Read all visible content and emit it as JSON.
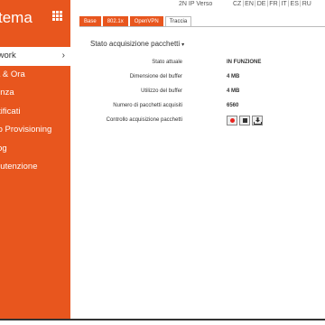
{
  "sidebar": {
    "title": "tema",
    "items": [
      {
        "label": "twork",
        "active": true
      },
      {
        "label": "a & Ora"
      },
      {
        "label": "enza"
      },
      {
        "label": "rtificati"
      },
      {
        "label": "to Provisioning"
      },
      {
        "label": "log"
      },
      {
        "label": "nutenzione"
      }
    ]
  },
  "topbar": {
    "product": "2N IP Verso",
    "languages": [
      "CZ",
      "EN",
      "DE",
      "FR",
      "IT",
      "ES",
      "RU"
    ]
  },
  "tabs": [
    "Base",
    "802.1x",
    "OpenVPN",
    "Traccia"
  ],
  "section": {
    "title": "Stato acquisizione pacchetti",
    "rows": [
      {
        "label": "Stato attuale",
        "value": "IN FUNZIONE"
      },
      {
        "label": "Dimensione del buffer",
        "value": "4 MB"
      },
      {
        "label": "Utilizzo del buffer",
        "value": "4 MB"
      },
      {
        "label": "Numero di pacchetti acquisiti",
        "value": "6560"
      }
    ],
    "control_label": "Controllo acquisizione pacchetti"
  },
  "icons": {
    "record": "record-icon",
    "stop": "stop-icon",
    "download": "download-icon",
    "grid": "grid-icon"
  },
  "colors": {
    "accent": "#e8561e",
    "record": "#e8231e"
  }
}
